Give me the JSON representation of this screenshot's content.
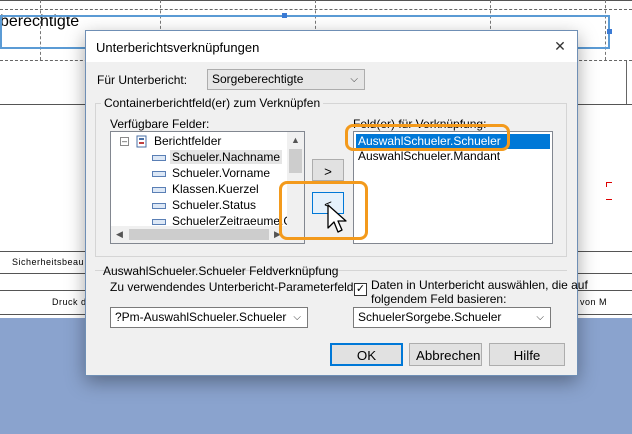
{
  "report": {
    "title_fragment": "berechtigte",
    "label_left": "Sicherheitsbeau",
    "label_druck": "Druck d",
    "label_von": "von M"
  },
  "dialog": {
    "title": "Unterberichtsverknüpfungen",
    "close_glyph": "✕",
    "subreport_label": "Für Unterbericht:",
    "subreport_value": "Sorgeberechtigte",
    "container_group_title": "Containerberichtfeld(er) zum Verknüpfen",
    "available_label": "Verfügbare Felder:",
    "tree_root": "Berichtfelder",
    "tree_items": [
      "Schueler.Nachname",
      "Schueler.Vorname",
      "Klassen.Kuerzel",
      "Schueler.Status",
      "SchuelerZeitraeume.Ge"
    ],
    "link_fields_label": "Feld(er) für Verknüpfung:",
    "link_fields": [
      "AuswahlSchueler.Schueler",
      "AuswahlSchueler.Mandant"
    ],
    "add_button": ">",
    "remove_button": "<",
    "link_group_title": "AuswahlSchueler.Schueler Feldverknüpfung",
    "param_label": "Zu verwendendes Unterbericht-Parameterfeld:",
    "param_value": "?Pm-AuswahlSchueler.Schueler",
    "select_checkbox_label_line1": "Daten in Unterbericht auswählen, die auf",
    "select_checkbox_label_line2": "folgendem Feld basieren:",
    "select_checkbox_checked": true,
    "select_field_value": "SchuelerSorgebe.Schueler",
    "ok_button": "OK",
    "cancel_button": "Abbrechen",
    "help_button": "Hilfe"
  },
  "colors": {
    "highlight": "#f39a1c",
    "selection": "#0078d7",
    "desktop": "#8aa3ce"
  }
}
